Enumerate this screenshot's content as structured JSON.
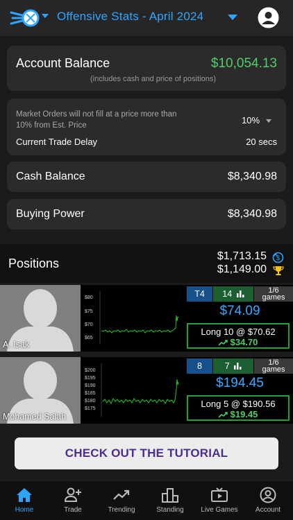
{
  "header": {
    "title": "Offensive Stats - April 2024",
    "accent": "#2ea6ff",
    "logo_icon": "rocket-football-logo",
    "profile_icon": "user-circle-icon"
  },
  "account": {
    "label": "Account Balance",
    "value": "$10,054.13",
    "note": "(includes cash and price of positions)",
    "value_color": "#4fcf6a"
  },
  "market": {
    "note": "Market Orders will not fill at a price more than 10% from Est. Price",
    "percent": "10%",
    "delay_label": "Current Trade Delay",
    "delay_value": "20 secs"
  },
  "cash": {
    "label": "Cash Balance",
    "value": "$8,340.98"
  },
  "buying": {
    "label": "Buying Power",
    "value": "$8,340.98"
  },
  "positions": {
    "title": "Positions",
    "value1": "$1,713.15",
    "value2": "$1,149.00",
    "icon1": "refresh-dollar-icon",
    "icon2": "trophy-icon"
  },
  "players": [
    {
      "name": "A. Isak",
      "rank": "T4",
      "points": "14",
      "games": "1/6",
      "games_label": "games",
      "price": "$74.09",
      "trade": "Long 10 @ $70.62",
      "gain": "$34.70",
      "y_ticks": [
        "$80",
        "$75",
        "$70",
        "$65"
      ]
    },
    {
      "name": "Mohamed Salah",
      "rank": "8",
      "points": "7",
      "games": "1/6",
      "games_label": "games",
      "price": "$194.45",
      "trade": "Long 5 @ $190.56",
      "gain": "$19.45",
      "y_ticks": [
        "$200",
        "$195",
        "$190",
        "$185",
        "$180",
        "$175"
      ]
    }
  ],
  "tutorial": {
    "label": "CHECK OUT THE TUTORIAL"
  },
  "nav": {
    "items": [
      {
        "label": "Home",
        "icon": "home-icon"
      },
      {
        "label": "Trade",
        "icon": "add-user-icon"
      },
      {
        "label": "Trending",
        "icon": "trending-icon"
      },
      {
        "label": "Standing",
        "icon": "podium-icon"
      },
      {
        "label": "Live Games",
        "icon": "tv-icon"
      },
      {
        "label": "Account",
        "icon": "account-icon"
      }
    ]
  }
}
